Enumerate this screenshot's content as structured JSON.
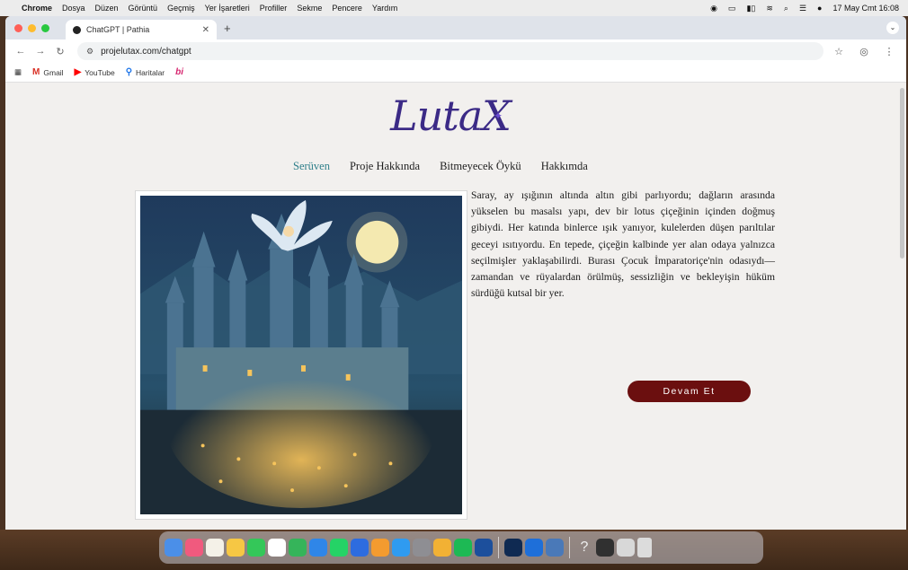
{
  "menubar": {
    "app": "Chrome",
    "items": [
      "Dosya",
      "Düzen",
      "Görüntü",
      "Geçmiş",
      "Yer İşaretleri",
      "Profiller",
      "Sekme",
      "Pencere",
      "Yardım"
    ],
    "datetime": "17 May Cmt 16:08"
  },
  "tab": {
    "title": "ChatGPT | Pathia"
  },
  "address": {
    "url": "projelutax.com/chatgpt"
  },
  "bookmarks": [
    {
      "label": "Gmail",
      "icon": "gmail-icon"
    },
    {
      "label": "YouTube",
      "icon": "youtube-icon"
    },
    {
      "label": "Haritalar",
      "icon": "maps-icon"
    },
    {
      "label": "bi",
      "icon": "bi-icon"
    }
  ],
  "site": {
    "logo": "LutaX",
    "nav": [
      "Serüven",
      "Proje Hakkında",
      "Bitmeyecek Öykü",
      "Hakkımda"
    ],
    "story": "Saray, ay ışığının altında altın gibi parlıyordu; dağların arasında yükselen bu masalsı yapı, dev bir lotus çiçeğinin içinden doğmuş gibiydi. Her katında binlerce ışık yanıyor, kulelerden düşen parıltılar geceyi ısıtıyordu. En tepede, çiçeğin kalbinde yer alan odaya yalnızca seçilmişler yaklaşabilirdi. Burası Çocuk İmparatoriçe'nin odasıydı—zamandan ve rüyalardan örülmüş, sessizliğin ve bekleyişin hüküm sürdüğü kutsal bir yer.",
    "continue_label": "Devam Et"
  },
  "colors": {
    "accent_nav": "#2f7f8a",
    "button_bg": "#6b0f0f",
    "logo": "#3b2a86"
  }
}
